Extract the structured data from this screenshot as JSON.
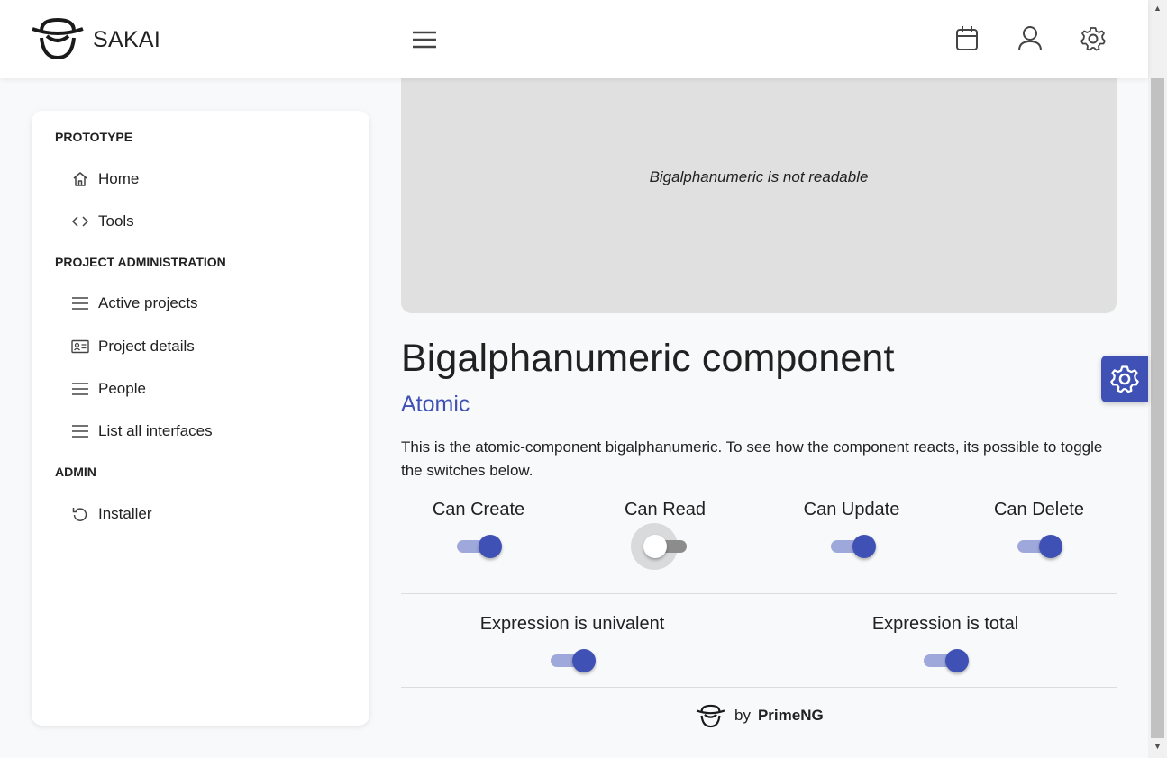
{
  "app": {
    "brand": "SAKAI",
    "logo_icon": "sakai-logo-icon",
    "menu_icon": "hamburger-menu-icon",
    "topbar_icons": [
      "calendar-icon",
      "user-icon",
      "gear-icon"
    ]
  },
  "sidebar": {
    "sections": [
      {
        "title": "PROTOTYPE",
        "items": [
          {
            "label": "Home",
            "icon": "home-icon"
          },
          {
            "label": "Tools",
            "icon": "code-icon"
          }
        ]
      },
      {
        "title": "PROJECT ADMINISTRATION",
        "items": [
          {
            "label": "Active projects",
            "icon": "bars-icon"
          },
          {
            "label": "Project details",
            "icon": "id-card-icon"
          },
          {
            "label": "People",
            "icon": "bars-icon"
          },
          {
            "label": "List all interfaces",
            "icon": "bars-icon"
          }
        ]
      },
      {
        "title": "ADMIN",
        "items": [
          {
            "label": "Installer",
            "icon": "refresh-icon"
          }
        ]
      }
    ]
  },
  "preview": {
    "message": "Bigalphanumeric is not readable"
  },
  "main": {
    "title": "Bigalphanumeric component",
    "subtitle": "Atomic",
    "description": "This is the atomic-component bigalphanumeric. To see how the component reacts, its possible to toggle the switches below.",
    "permissions": [
      {
        "label": "Can Create",
        "checked": true
      },
      {
        "label": "Can Read",
        "checked": false
      },
      {
        "label": "Can Update",
        "checked": true
      },
      {
        "label": "Can Delete",
        "checked": true
      }
    ],
    "expressions": [
      {
        "label": "Expression is univalent",
        "checked": true
      },
      {
        "label": "Expression is total",
        "checked": true
      }
    ]
  },
  "footer": {
    "by": "by",
    "name": "PrimeNG",
    "logo_icon": "primeng-logo-icon"
  },
  "config_button": {
    "icon": "gear-icon"
  },
  "colors": {
    "accent": "#3f51b5",
    "accent_light": "#9fa8da",
    "background": "#f8f9fa",
    "preview_bg": "#e0e0e0"
  }
}
